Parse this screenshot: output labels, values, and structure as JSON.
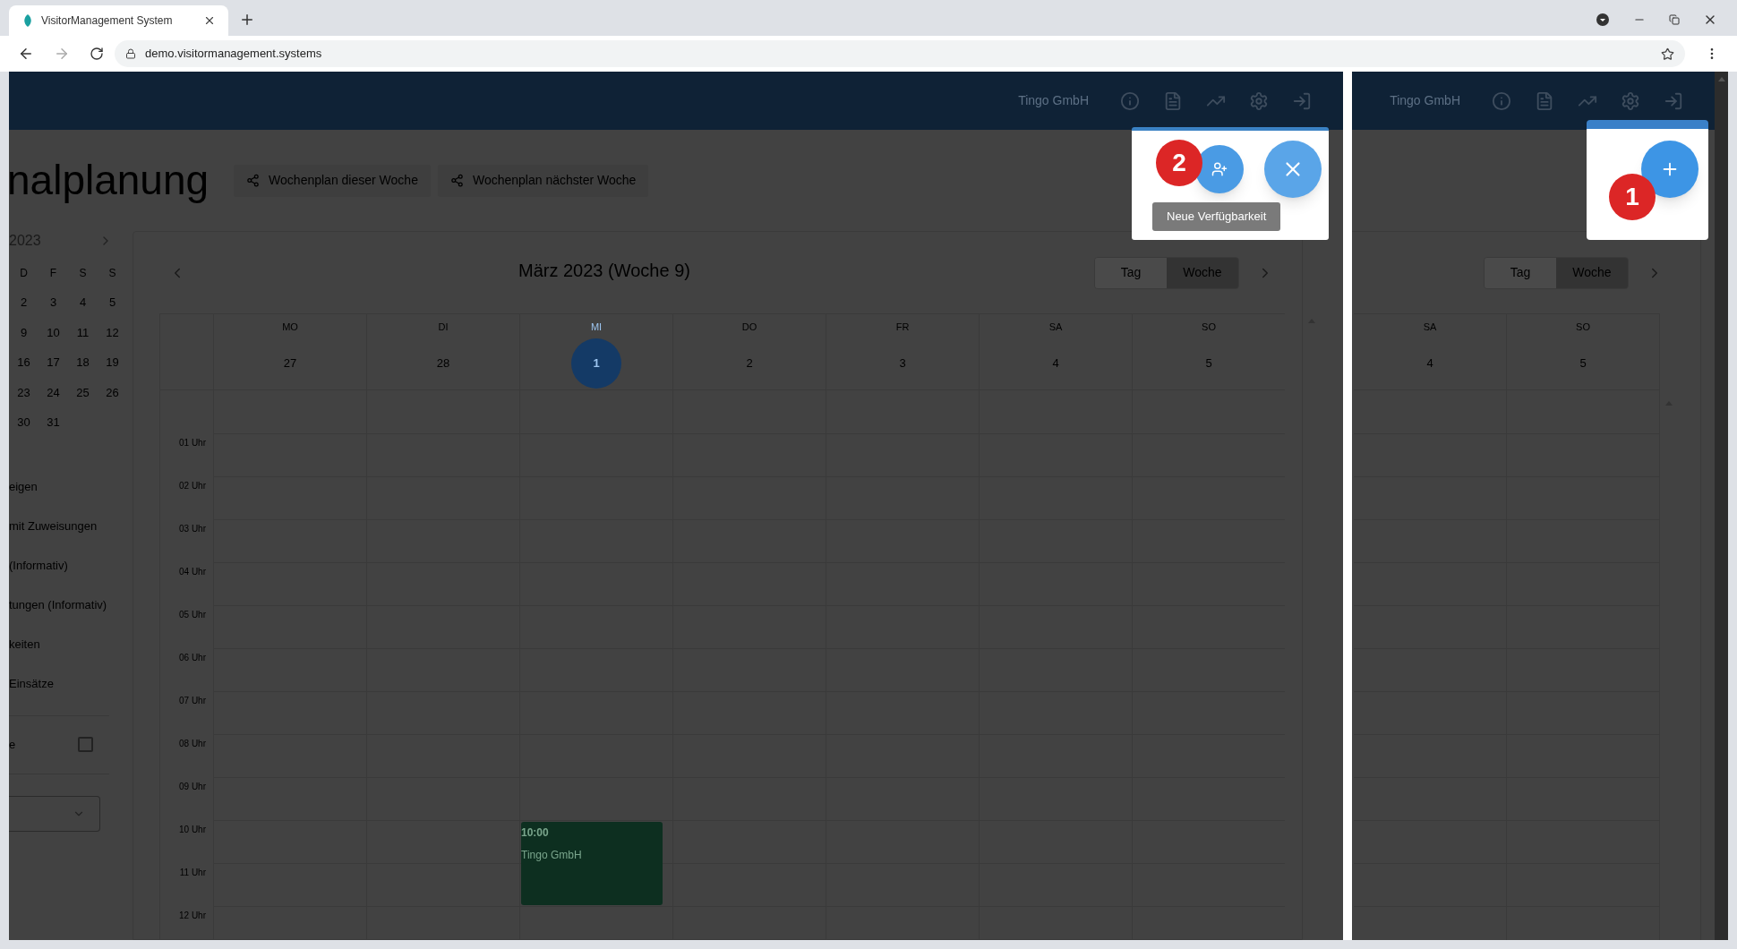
{
  "browser": {
    "tab_title": "VisitorManagement System",
    "url": "demo.visitormanagement.systems"
  },
  "left_view": {
    "company": "Tingo GmbH",
    "page_title": "nalplanung",
    "share_buttons": [
      "Wochenplan dieser Woche",
      "Wochenplan nächster Woche"
    ],
    "mini_calendar": {
      "title": "2023",
      "weekdays": [
        "D",
        "F",
        "S",
        "S"
      ],
      "weeks": [
        [
          "2",
          "3",
          "4",
          "5"
        ],
        [
          "9",
          "10",
          "11",
          "12"
        ],
        [
          "16",
          "17",
          "18",
          "19"
        ],
        [
          "23",
          "24",
          "25",
          "26"
        ],
        [
          "30",
          "31"
        ]
      ]
    },
    "filters": [
      "eigen",
      "mit Zuweisungen",
      "(Informativ)",
      "tungen (Informativ)",
      "keiten",
      "Einsätze"
    ],
    "checkbox": {
      "label": "e",
      "checked": false
    },
    "calendar": {
      "title": "März 2023 (Woche 9)",
      "view_toggle": [
        {
          "label": "Tag",
          "selected": false
        },
        {
          "label": "Woche",
          "selected": true
        }
      ],
      "days": [
        {
          "name": "MO",
          "date": "27",
          "selected": false
        },
        {
          "name": "DI",
          "date": "28",
          "selected": false
        },
        {
          "name": "MI",
          "date": "1",
          "selected": true,
          "events": [
            {
              "time": "10:00",
              "title": "Tingo GmbH"
            }
          ]
        },
        {
          "name": "DO",
          "date": "2",
          "selected": false
        },
        {
          "name": "FR",
          "date": "3",
          "selected": false
        },
        {
          "name": "SA",
          "date": "4",
          "selected": false
        },
        {
          "name": "SO",
          "date": "5",
          "selected": false
        }
      ],
      "hours": [
        "01 Uhr",
        "02 Uhr",
        "03 Uhr",
        "04 Uhr",
        "05 Uhr",
        "06 Uhr",
        "07 Uhr",
        "08 Uhr",
        "09 Uhr",
        "10 Uhr",
        "11 Uhr",
        "12 Uhr"
      ]
    },
    "popup": {
      "badge": "2",
      "tooltip": "Neue Verfügbarkeit"
    }
  },
  "right_view": {
    "company": "Tingo GmbH",
    "view_toggle": [
      {
        "label": "Tag",
        "selected": false
      },
      {
        "label": "Woche",
        "selected": true
      }
    ],
    "days": [
      {
        "name": "SA",
        "date": "4"
      },
      {
        "name": "SO",
        "date": "5"
      }
    ],
    "popup": {
      "badge": "1"
    }
  }
}
